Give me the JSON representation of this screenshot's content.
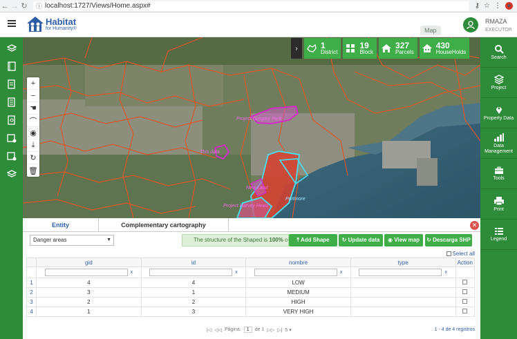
{
  "browser": {
    "url": "localhost:1727/Views/Home.aspx#"
  },
  "header": {
    "logo_line1": "Habitat",
    "logo_line2": "for Humanity®",
    "map_tab": "Map",
    "user_name": "RMAZA",
    "user_role": "EXECUTOR"
  },
  "stats": [
    {
      "icon": "map-outline-icon",
      "value": "1",
      "label": "District"
    },
    {
      "icon": "grid-block-icon",
      "value": "19",
      "label": "Block"
    },
    {
      "icon": "house-icon",
      "value": "327",
      "label": "Parcels"
    },
    {
      "icon": "households-icon",
      "value": "430",
      "label": "HouseHolds"
    }
  ],
  "map_labels": {
    "gregory": "Project Gregory Park",
    "this_data": "This data",
    "new_land": "New Land",
    "portmore": "Portmore",
    "harvey": "Project Harvey Head"
  },
  "right_sidebar": [
    {
      "icon": "search-icon",
      "label": "Search"
    },
    {
      "icon": "layers-icon",
      "label": "Project"
    },
    {
      "icon": "map-pin-icon",
      "label": "Property Data"
    },
    {
      "icon": "bar-chart-icon",
      "label": "Data Management"
    },
    {
      "icon": "toolbox-icon",
      "label": "Tools"
    },
    {
      "icon": "printer-icon",
      "label": "Print"
    },
    {
      "icon": "legend-icon",
      "label": "Legend"
    }
  ],
  "panel": {
    "tabs": [
      "Entity",
      "Complementary cartography"
    ],
    "select_value": "Danger areas",
    "notice": "The structure of the Shaped is 100% cor",
    "buttons": {
      "add_shape": "Add Shape",
      "update_data": "Update data",
      "view_map": "View map",
      "download_shp": "Descarga SHP"
    },
    "select_all": "Select all",
    "columns": [
      "gid",
      "id",
      "nombre",
      "type",
      "Action"
    ],
    "rows": [
      {
        "n": "1",
        "gid": "4",
        "id": "4",
        "nombre": "LOW",
        "type": ""
      },
      {
        "n": "2",
        "gid": "3",
        "id": "1",
        "nombre": "MEDIUM",
        "type": ""
      },
      {
        "n": "3",
        "gid": "2",
        "id": "2",
        "nombre": "HIGH",
        "type": ""
      },
      {
        "n": "4",
        "gid": "1",
        "id": "3",
        "nombre": "VERY HIGH",
        "type": ""
      }
    ],
    "pager": {
      "first": "|◁",
      "prev": "◁◁",
      "page_label": "Página:",
      "page": "1",
      "of_label": "de 1",
      "next": "▷▷",
      "last": "▷|",
      "page_size": "5"
    },
    "records": "1 - 4 de 4 registros"
  },
  "colors": {
    "green": "#2e8b3a",
    "stat_green": "#3fae49",
    "blue": "#2e5da8",
    "parcel_outline": "#e0562a",
    "project_magenta": "#d12fc4",
    "cyan": "#4fd7e6",
    "danger_red": "#d8402e"
  }
}
